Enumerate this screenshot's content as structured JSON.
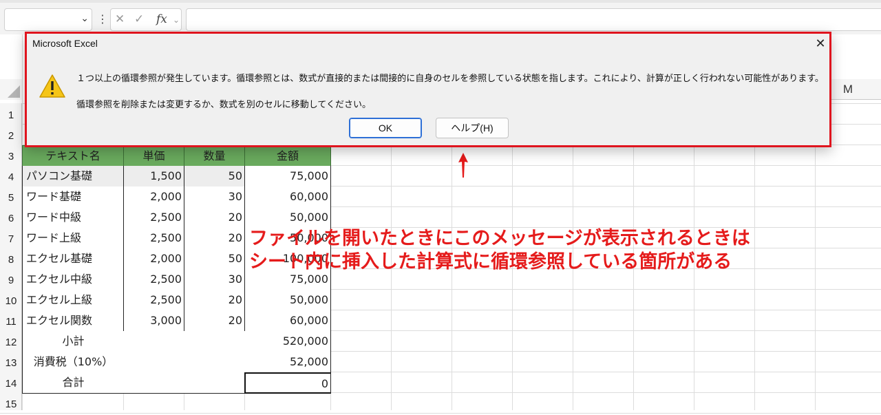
{
  "formula_bar": {
    "name_box_value": "",
    "cancel_icon": "close-icon",
    "enter_icon": "check-icon",
    "fx_label": "fx",
    "formula_value": ""
  },
  "column_header_visible": "M",
  "row_numbers": [
    "1",
    "2",
    "3",
    "4",
    "5",
    "6",
    "7",
    "8",
    "9",
    "10",
    "11",
    "12",
    "13",
    "14",
    "15"
  ],
  "table": {
    "headers": [
      "テキスト名",
      "単価",
      "数量",
      "金額"
    ],
    "rows": [
      [
        "パソコン基礎",
        "1,500",
        "50",
        "75,000"
      ],
      [
        "ワード基礎",
        "2,000",
        "30",
        "60,000"
      ],
      [
        "ワード中級",
        "2,500",
        "20",
        "50,000"
      ],
      [
        "ワード上級",
        "2,500",
        "20",
        "50,000"
      ],
      [
        "エクセル基礎",
        "2,000",
        "50",
        "100,000"
      ],
      [
        "エクセル中級",
        "2,500",
        "30",
        "75,000"
      ],
      [
        "エクセル上級",
        "2,500",
        "20",
        "50,000"
      ],
      [
        "エクセル関数",
        "3,000",
        "20",
        "60,000"
      ]
    ],
    "subtotal_label": "小計",
    "subtotal_value": "520,000",
    "tax_label": "消費税（10%）",
    "tax_value": "52,000",
    "total_label": "合計",
    "total_value": "0"
  },
  "dialog": {
    "title": "Microsoft Excel",
    "close_glyph": "✕",
    "message_line1": "１つ以上の循環参照が発生しています。循環参照とは、数式が直接的または間接的に自身のセルを参照している状態を指します。これにより、計算が正しく行われない可能性があります。",
    "message_line2": "循環参照を削除または変更するか、数式を別のセルに移動してください。",
    "ok_label": "OK",
    "help_label": "ヘルプ(H)",
    "icon": "warning-icon"
  },
  "annotation": {
    "line1": "ファイルを開いたときにこのメッセージが表示されるときは",
    "line2": "シート内に挿入した計算式に循環参照している箇所がある",
    "color": "#e51b1b"
  },
  "colors": {
    "header_fill": "#6aab5e",
    "dialog_border": "#e0141e",
    "ok_border": "#2d6fd6"
  }
}
